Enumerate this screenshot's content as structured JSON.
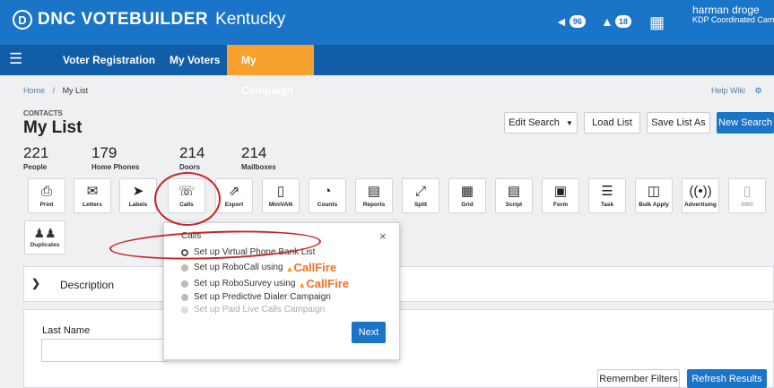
{
  "app": {
    "brand_letter": "D",
    "brand": "DNC VOTEBUILDER",
    "state": "Kentucky"
  },
  "topbar": {
    "notifications": {
      "icon": "megaphone-icon",
      "count": "96"
    },
    "alerts": {
      "icon": "bell-icon",
      "count": "18"
    },
    "apps_icon": "grid-icon",
    "user_name": "harman droge",
    "user_org": "KDP Coordinated Campaign"
  },
  "nav": {
    "items": [
      "Voter Registration",
      "My Voters",
      "My Campaign"
    ],
    "active": "My Campaign"
  },
  "breadcrumb": {
    "home": "Home",
    "sep": "/",
    "current": "My List"
  },
  "help": "Help Wiki",
  "section_label": "CONTACTS",
  "page_title": "My List",
  "actions": {
    "edit_search": "Edit Search",
    "load_list": "Load List",
    "save_list_as": "Save List As",
    "new_search": "New Search"
  },
  "stats": [
    {
      "value": "221",
      "label": "People"
    },
    {
      "value": "179",
      "label": "Home Phones"
    },
    {
      "value": "214",
      "label": "Doors"
    },
    {
      "value": "214",
      "label": "Mailboxes"
    }
  ],
  "tools": [
    {
      "label": "Print",
      "icon": "printer-icon"
    },
    {
      "label": "Letters",
      "icon": "envelope-icon"
    },
    {
      "label": "Labels",
      "icon": "tag-icon"
    },
    {
      "label": "Calls",
      "icon": "phone-icon"
    },
    {
      "label": "Export",
      "icon": "export-icon"
    },
    {
      "label": "MiniVAN",
      "icon": "mobile-icon"
    },
    {
      "label": "Counts",
      "icon": "pie-icon"
    },
    {
      "label": "Reports",
      "icon": "report-icon"
    },
    {
      "label": "Split",
      "icon": "split-icon"
    },
    {
      "label": "Grid",
      "icon": "table-icon"
    },
    {
      "label": "Script",
      "icon": "script-icon"
    },
    {
      "label": "Form",
      "icon": "form-icon"
    },
    {
      "label": "Task",
      "icon": "list-icon"
    },
    {
      "label": "Bulk Apply",
      "icon": "bulk-icon"
    },
    {
      "label": "Advertising",
      "icon": "broadcast-icon"
    },
    {
      "label": "SMS",
      "icon": "sms-icon"
    }
  ],
  "duplicates": {
    "label": "Duplicates",
    "icon": "people-icon"
  },
  "description": {
    "label": "Description"
  },
  "filters": {
    "last_name_label": "Last Name",
    "last_name_value": "",
    "remember": "Remember Filters",
    "refresh": "Refresh Results"
  },
  "calls_popup": {
    "title": "Calls",
    "close": "×",
    "options": [
      {
        "label": "Set up Virtual Phone Bank List",
        "selected": true,
        "disabled": false
      },
      {
        "label": "Set up RoboCall using",
        "brand": "CallFire",
        "selected": false,
        "disabled": false
      },
      {
        "label": "Set up RoboSurvey using",
        "brand": "CallFire",
        "selected": false,
        "disabled": false
      },
      {
        "label": "Set up Predictive Dialer Campaign",
        "selected": false,
        "disabled": false
      },
      {
        "label": "Set up Paid Live Calls Campaign",
        "selected": false,
        "disabled": true
      }
    ],
    "next": "Next"
  },
  "colors": {
    "topbar": "#1a74c8",
    "nav": "#115da7",
    "active_tab": "#f6a12d",
    "primary": "#1a74c8",
    "annotation": "#c8242a",
    "callfire": "#f37021"
  }
}
